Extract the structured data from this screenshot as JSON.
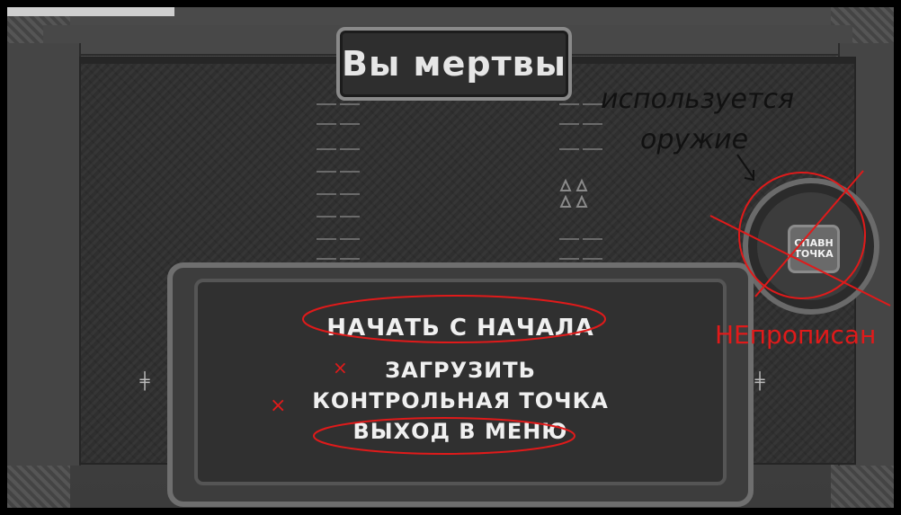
{
  "dialog": {
    "title": "Вы мертвы",
    "menu": [
      {
        "label": "НАЧАТЬ С НАЧАЛА"
      },
      {
        "label": "ЗАГРУЗИТЬ"
      },
      {
        "label": "КОНТРОЛЬНАЯ ТОЧКА"
      },
      {
        "label": "ВЫХОД В МЕНЮ"
      }
    ]
  },
  "spawn_button": {
    "line1": "СПАВН",
    "line2": "ТОЧКА"
  },
  "annotations": {
    "note_line1": "используется",
    "note_line2": "оружие",
    "not_implemented": "НЕпрописан",
    "cross_mark": "×",
    "color": "#e01a1a"
  },
  "colors": {
    "frame": "#3a3a3a",
    "floor": "#2f2f2f",
    "text": "#f0f0f0",
    "annotation": "#e01a1a"
  }
}
